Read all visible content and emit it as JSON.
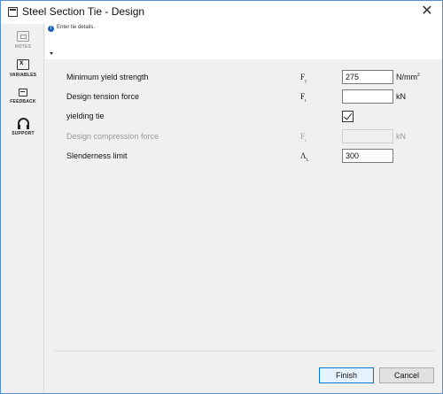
{
  "window": {
    "title": "Steel Section Tie - Design",
    "close_glyph": "✕"
  },
  "sidebar": {
    "items": [
      {
        "label": "NOTES",
        "icon": "notes-icon",
        "enabled": false
      },
      {
        "label": "VARIABLES",
        "icon": "variables-icon",
        "enabled": true
      },
      {
        "label": "FEEDBACK",
        "icon": "feedback-icon",
        "enabled": true
      },
      {
        "label": "SUPPORT",
        "icon": "headset-icon",
        "enabled": true
      }
    ]
  },
  "info": {
    "icon_glyph": "i",
    "text": "Enter tie details."
  },
  "form": {
    "rows": [
      {
        "label": "Minimum yield strength",
        "symbol": "F",
        "symbol_sub": "y",
        "value": "275",
        "unit": "N/mm",
        "unit_sup": "2",
        "enabled": true
      },
      {
        "label": "Design tension force",
        "symbol": "F",
        "symbol_sub": "t",
        "value": "",
        "unit": "kN",
        "enabled": true
      },
      {
        "label": "yielding tie",
        "checked": true,
        "enabled": true
      },
      {
        "label": "Design compression force",
        "symbol": "F",
        "symbol_sub": "c",
        "value": "",
        "unit": "kN",
        "enabled": false
      },
      {
        "label": "Slenderness limit",
        "symbol": "Λ",
        "symbol_sub": "L",
        "value": "300",
        "unit": "",
        "enabled": true
      }
    ]
  },
  "buttons": {
    "finish": "Finish",
    "cancel": "Cancel"
  },
  "colors": {
    "accent": "#0078d7",
    "info_icon": "#1e5fb3",
    "window_border": "#5b8fc9"
  }
}
